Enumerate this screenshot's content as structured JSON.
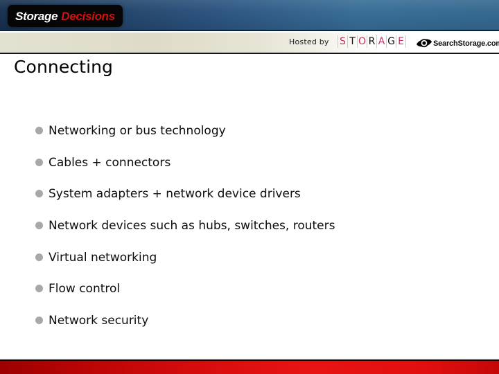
{
  "banner": {
    "logo": {
      "word_one": "Storage",
      "word_two": "Decisions",
      "color_word_one": "#ffffff",
      "color_word_two": "#d21111",
      "background": "#060606"
    },
    "background_gradient_from": "#17304f",
    "background_gradient_to": "#34688f"
  },
  "strip": {
    "hosted_by_label": "Hosted by",
    "storage_wordmark": {
      "letters": [
        "S",
        "T",
        "O",
        "R",
        "A",
        "G",
        "E"
      ],
      "letter_colors": [
        "#c4325c",
        "#111111",
        "#c4325c",
        "#111111",
        "#c4325c",
        "#111111",
        "#c4325c"
      ]
    },
    "searchstorage": {
      "icon": "eye-icon",
      "label": "SearchStorage.com"
    }
  },
  "slide": {
    "title": "Connecting",
    "bullets": [
      {
        "text": "Networking or bus technology"
      },
      {
        "text": "Cables +  connectors"
      },
      {
        "text": "System adapters + network device drivers"
      },
      {
        "text": "Network devices such as hubs, switches, routers"
      },
      {
        "text": "Virtual networking"
      },
      {
        "text": "Flow control"
      },
      {
        "text": "Network security"
      }
    ],
    "bullet_marker_color": "#a8a8a8"
  },
  "footer": {
    "accent_color": "#d80d0d"
  }
}
